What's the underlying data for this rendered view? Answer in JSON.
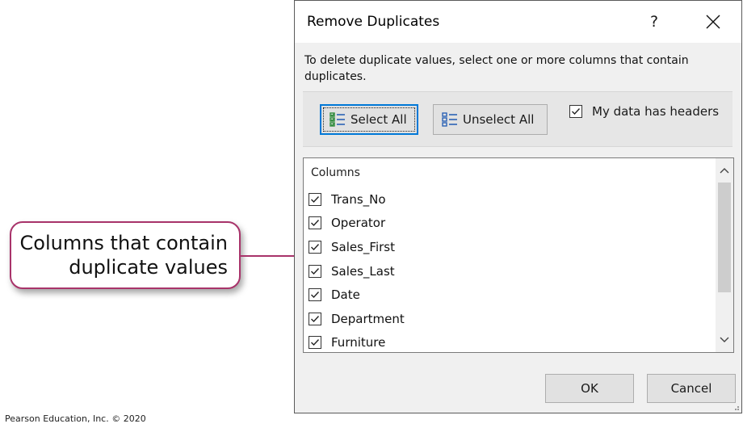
{
  "callout": {
    "line1": "Columns that contain",
    "line2": "duplicate values"
  },
  "footer": {
    "credit": "Pearson Education, Inc. © 2020"
  },
  "dialog": {
    "title": "Remove Duplicates",
    "help_label": "?",
    "instructions": "To delete duplicate values, select one or more columns that contain duplicates.",
    "select_all_label": "Select All",
    "unselect_all_label": "Unselect All",
    "headers_label": "My data has headers",
    "headers_checked": true,
    "columns_header": "Columns",
    "columns": [
      {
        "label": "Trans_No",
        "checked": true
      },
      {
        "label": "Operator",
        "checked": true
      },
      {
        "label": "Sales_First",
        "checked": true
      },
      {
        "label": "Sales_Last",
        "checked": true
      },
      {
        "label": "Date",
        "checked": true
      },
      {
        "label": "Department",
        "checked": true
      },
      {
        "label": "Furniture",
        "checked": true
      }
    ],
    "ok_label": "OK",
    "cancel_label": "Cancel"
  },
  "colors": {
    "callout_border": "#a8336a",
    "focus_blue": "#0078d7",
    "dialog_bg": "#f0f0f0"
  }
}
